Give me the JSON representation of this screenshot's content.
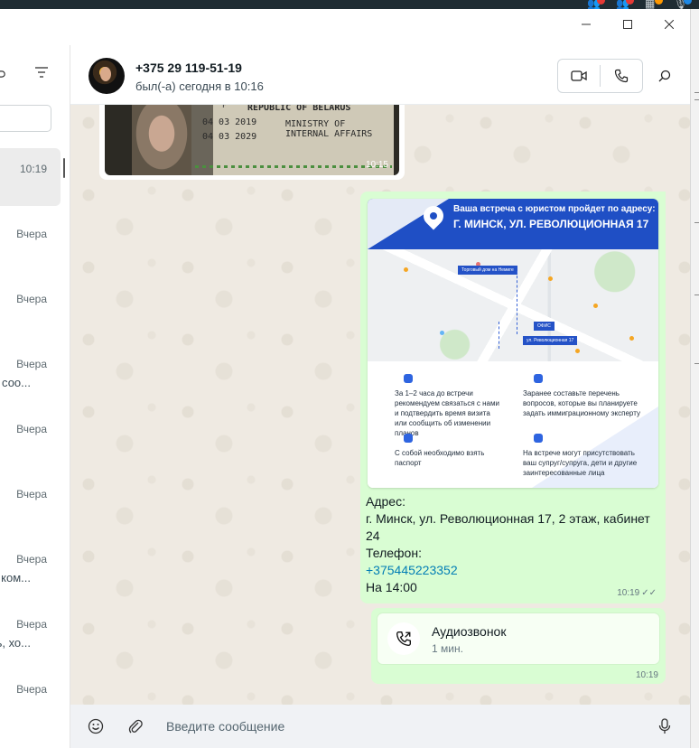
{
  "system_tray": {
    "items": [
      {
        "icon": "people-icon",
        "badge_color": "#e53935"
      },
      {
        "icon": "people-icon",
        "badge_color": "#e53935"
      },
      {
        "icon": "calendar-icon",
        "badge_color": "#ff9800"
      },
      {
        "icon": "mic-icon",
        "badge_color": "#1e88e5"
      }
    ]
  },
  "window": {
    "minimize_icon": "minimize-icon",
    "maximize_icon": "maximize-icon",
    "close_icon": "close-icon"
  },
  "sidebar": {
    "chats": [
      {
        "time": "10:19",
        "snippet": "",
        "active": true
      },
      {
        "time": "Вчера",
        "snippet": ""
      },
      {
        "time": "Вчера",
        "snippet": ""
      },
      {
        "time": "Вчера",
        "snippet": "соо..."
      },
      {
        "time": "Вчера",
        "snippet": ""
      },
      {
        "time": "Вчера",
        "snippet": ""
      },
      {
        "time": "Вчера",
        "snippet": "ком..."
      },
      {
        "time": "Вчера",
        "snippet": "ь, хо..."
      },
      {
        "time": "Вчера",
        "snippet": ""
      }
    ]
  },
  "header": {
    "contact_name": "+375 29 119-51-19",
    "status": "был(-а) сегодня в 10:16"
  },
  "messages": {
    "passport_image": {
      "time": "10:15",
      "lines": [
        "F",
        "REPUBLIC OF BELARUS",
        "04 03 2019",
        "MINISTRY OF",
        "04 03 2029",
        "INTERNAL AFFAIRS"
      ]
    },
    "appointment": {
      "flyer": {
        "banner_line1": "Ваша встреча с юристом пройдет по адресу:",
        "banner_line2": "Г. МИНСК, УЛ. РЕВОЛЮЦИОННАЯ 17",
        "map_labels": [
          "Торговый дом на Немиге",
          "ОФИС",
          "ул. Революционная 17"
        ],
        "tips": [
          "За 1–2 часа до встречи рекомендуем связаться с нами и подтвердить время визита или сообщить об изменении планов",
          "Заранее составьте перечень вопросов, которые вы планируете задать иммиграционному эксперту",
          "С собой необходимо взять паспорт",
          "На встрече могут присутствовать ваш супруг/супруга, дети и другие заинтересованные лица"
        ]
      },
      "text_lines": [
        "Адрес:",
        "г. Минск, ул. Революционная 17, 2 этаж, кабинет 24",
        "Телефон:"
      ],
      "phone": "+375445223352",
      "time_line": "На 14:00",
      "time": "10:19"
    },
    "call": {
      "title": "Аудиозвонок",
      "duration": "1 мин.",
      "time": "10:19"
    }
  },
  "composer": {
    "placeholder": "Введите сообщение"
  },
  "colors": {
    "outgoing_bubble": "#d9fdd3",
    "chat_background": "#efeae2",
    "link": "#027eb5",
    "flyer_blue": "#1f4fc5"
  }
}
